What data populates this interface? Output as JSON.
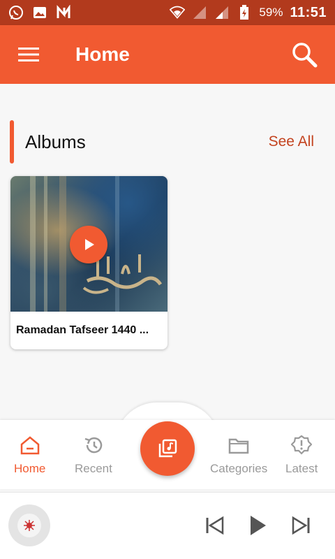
{
  "status_bar": {
    "battery": "59%",
    "time": "11:51",
    "icons": [
      "whatsapp-icon",
      "gallery-icon",
      "app-n-icon",
      "wifi-icon",
      "signal-icon",
      "signal-icon",
      "battery-icon"
    ]
  },
  "app_bar": {
    "title": "Home",
    "menu_icon": "menu-icon",
    "search_icon": "search-icon"
  },
  "albums_section": {
    "title": "Albums",
    "see_all": "See All",
    "albums": [
      {
        "title": "Ramadan Tafseer 1440 ..."
      }
    ]
  },
  "bottom_nav": {
    "items": [
      {
        "label": "Home",
        "icon": "home-icon",
        "active": true
      },
      {
        "label": "Recent",
        "icon": "history-icon",
        "active": false
      },
      {
        "label": "Categories",
        "icon": "folder-icon",
        "active": false
      },
      {
        "label": "Latest",
        "icon": "badge-alert-icon",
        "active": false
      }
    ],
    "center_icon": "music-library-icon"
  },
  "player": {
    "controls": [
      "skip-previous-icon",
      "play-icon",
      "skip-next-icon"
    ]
  },
  "colors": {
    "primary": "#f15a31",
    "status_bar": "#b23a1d",
    "inactive": "#9a9a9a"
  }
}
